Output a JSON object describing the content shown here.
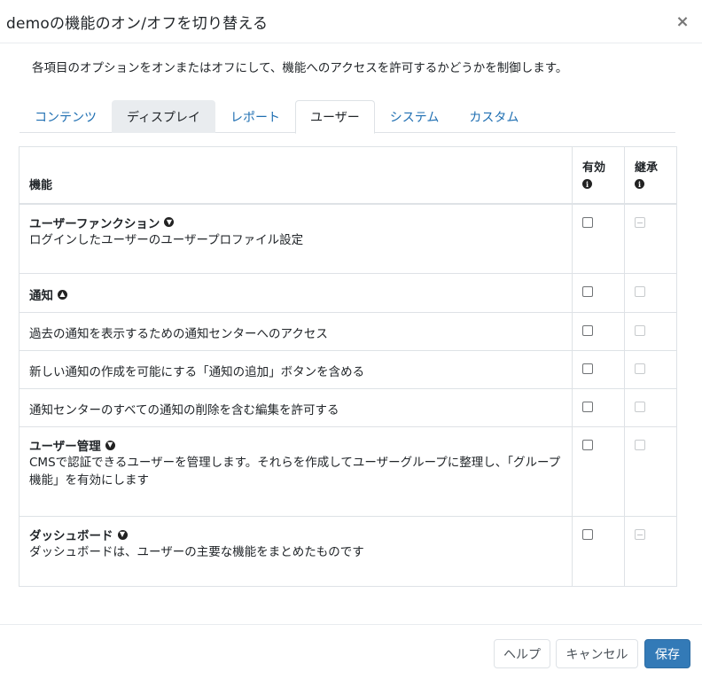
{
  "dialog": {
    "title": "demoの機能のオン/オフを切り替える",
    "close_label": "×",
    "intro": "各項目のオプションをオンまたはオフにして、機能へのアクセスを許可するかどうかを制御します。"
  },
  "tabs": [
    {
      "label": "コンテンツ"
    },
    {
      "label": "ディスプレイ"
    },
    {
      "label": "レポート"
    },
    {
      "label": "ユーザー",
      "active": true
    },
    {
      "label": "システム"
    },
    {
      "label": "カスタム"
    }
  ],
  "table": {
    "headers": {
      "feature": "機能",
      "enabled": "有効",
      "inherit": "継承",
      "info_glyph": "i"
    },
    "rows": {
      "user_functions": {
        "name": "ユーザーファンクション",
        "toggle_icon": "circle-arrow-down-icon",
        "description": "ログインしたユーザーのユーザープロファイル設定"
      },
      "notifications": {
        "name": "通知",
        "toggle_icon": "circle-arrow-up-icon"
      },
      "notif_center": {
        "description": "過去の通知を表示するための通知センターへのアクセス"
      },
      "notif_add": {
        "description": "新しい通知の作成を可能にする「通知の追加」ボタンを含める"
      },
      "notif_edit": {
        "description": "通知センターのすべての通知の削除を含む編集を許可する"
      },
      "user_management": {
        "name": "ユーザー管理",
        "toggle_icon": "circle-arrow-down-icon",
        "description": "CMSで認証できるユーザーを管理します。それらを作成してユーザーグループに整理し、「グループ機能」を有効にします"
      },
      "dashboard": {
        "name": "ダッシュボード",
        "toggle_icon": "circle-arrow-down-icon",
        "description": "ダッシュボードは、ユーザーの主要な機能をまとめたものです"
      }
    }
  },
  "footer": {
    "help_label": "ヘルプ",
    "cancel_label": "キャンセル",
    "save_label": "保存"
  },
  "colors": {
    "link": "#1f6fb2",
    "primary": "#337ab7"
  }
}
